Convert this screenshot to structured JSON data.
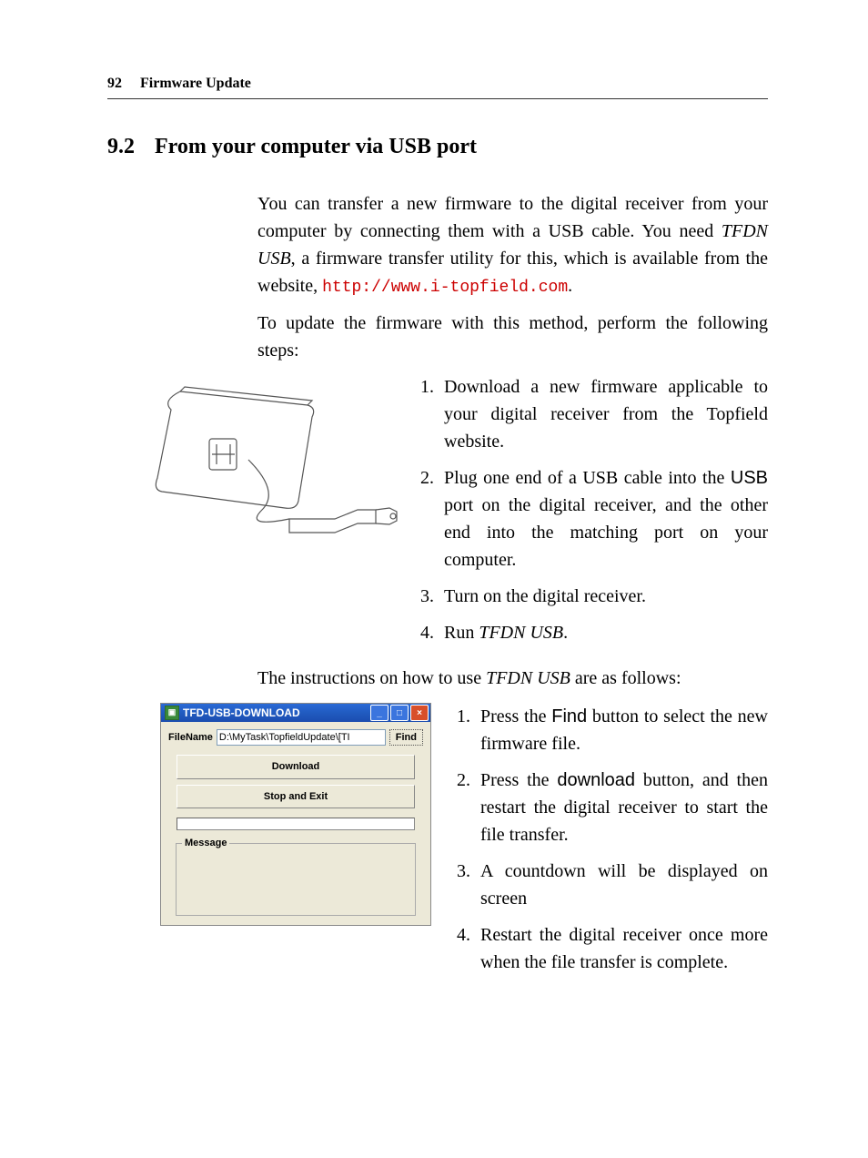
{
  "page_header": {
    "page_number": "92",
    "chapter_title": "Firmware Update"
  },
  "section": {
    "number": "9.2",
    "title": "From your computer via USB port"
  },
  "intro": {
    "p1_a": "You can transfer a new firmware to the digital receiver from your computer by connecting them with a USB cable. You need ",
    "p1_i": "TFDN USB",
    "p1_b": ", a firmware transfer utility for this, which is available from the website, ",
    "url": "http://www.i-topfield.com",
    "p1_c": ".",
    "p2": "To update the firmware with this method, perform the following steps:"
  },
  "steps_top": {
    "s1": "Download a new firmware applicable to your digital receiver from the Topfield website.",
    "s2_a": "Plug one end of a USB cable into the ",
    "s2_sans": "USB",
    "s2_b": " port on the digital receiver, and the other end into the matching port on your computer.",
    "s3": "Turn on the digital receiver.",
    "s4_a": "Run ",
    "s4_i": "TFDN USB",
    "s4_b": "."
  },
  "mid_para_a": "The instructions on how to use ",
  "mid_para_i": "TFDN USB",
  "mid_para_b": " are as follows:",
  "dialog": {
    "title": "TFD-USB-DOWNLOAD",
    "filename_label": "FileName",
    "filename_value": "D:\\MyTask\\TopfieldUpdate\\[TI",
    "find_label": "Find",
    "download_label": "Download",
    "stop_label": "Stop and Exit",
    "message_label": "Message"
  },
  "steps_tfd": {
    "s1_a": "Press the ",
    "s1_sans": "Find",
    "s1_b": " button to select the new firmware file.",
    "s2_a": "Press the ",
    "s2_sans": "download",
    "s2_b": " button, and then restart the digital receiver to start the file transfer.",
    "s3": "A countdown will be displayed on screen",
    "s4": "Restart the digital receiver once more when the file transfer is complete."
  }
}
